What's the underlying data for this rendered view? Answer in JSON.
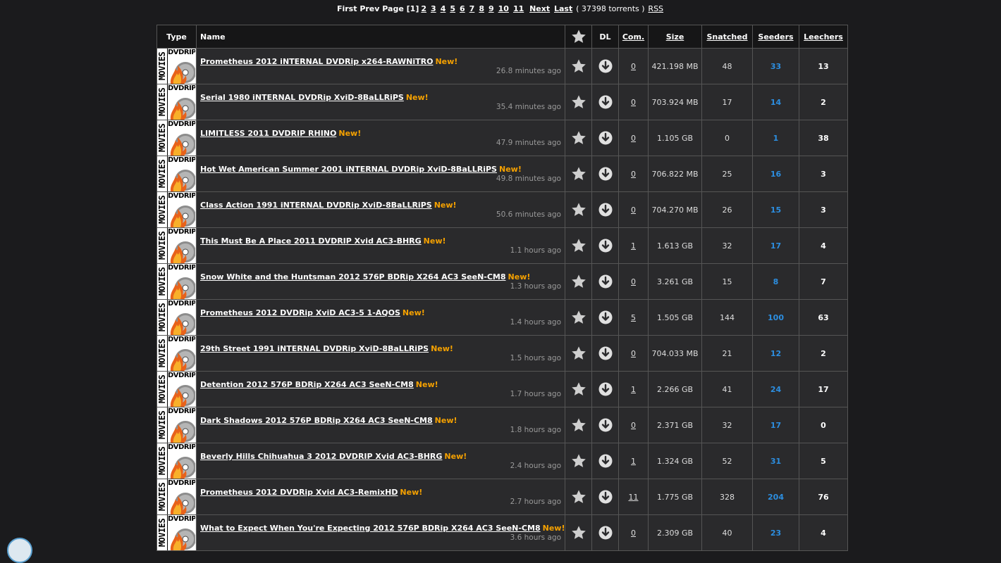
{
  "pager": {
    "first": "First",
    "prev": "Prev",
    "page_label": "Page",
    "current": "[1]",
    "pages": [
      "2",
      "3",
      "4",
      "5",
      "6",
      "7",
      "8",
      "9",
      "10",
      "11"
    ],
    "next": "Next",
    "last": "Last",
    "count_text": "( 37398 torrents )",
    "rss": "RSS"
  },
  "headers": {
    "type": "Type",
    "name": "Name",
    "dl": "DL",
    "com": "Com.",
    "size": "Size",
    "snatched": "Snatched",
    "seeders": "Seeders",
    "leechers": "Leechers"
  },
  "type_icon": {
    "vertical": "MOVIES",
    "top": "DVDRIP"
  },
  "new_label": "New!",
  "colors": {
    "new": "#f5a100",
    "seeders": "#2c8ee0",
    "background": "#1b1b1d"
  },
  "rows": [
    {
      "name": "Prometheus 2012 iNTERNAL DVDRip x264-RAWNiTRO",
      "added": "26.8 minutes ago",
      "com": "0",
      "size": "421.198 MB",
      "snatched": "48",
      "seeders": "33",
      "leechers": "13"
    },
    {
      "name": "Serial 1980 iNTERNAL DVDRip XviD-8BaLLRiPS",
      "added": "35.4 minutes ago",
      "com": "0",
      "size": "703.924 MB",
      "snatched": "17",
      "seeders": "14",
      "leechers": "2"
    },
    {
      "name": "LIMITLESS 2011 DVDRIP RHINO",
      "added": "47.9 minutes ago",
      "com": "0",
      "size": "1.105 GB",
      "snatched": "0",
      "seeders": "1",
      "leechers": "38"
    },
    {
      "name": "Hot Wet American Summer 2001 iNTERNAL DVDRip XviD-8BaLLRiPS",
      "added": "49.8 minutes ago",
      "com": "0",
      "size": "706.822 MB",
      "snatched": "25",
      "seeders": "16",
      "leechers": "3"
    },
    {
      "name": "Class Action 1991 iNTERNAL DVDRip XviD-8BaLLRiPS",
      "added": "50.6 minutes ago",
      "com": "0",
      "size": "704.270 MB",
      "snatched": "26",
      "seeders": "15",
      "leechers": "3"
    },
    {
      "name": "This Must Be A Place 2011 DVDRIP Xvid AC3-BHRG",
      "added": "1.1 hours ago",
      "com": "1",
      "size": "1.613 GB",
      "snatched": "32",
      "seeders": "17",
      "leechers": "4"
    },
    {
      "name": "Snow White and the Huntsman 2012 576P BDRip X264 AC3 SeeN-CM8",
      "added": "1.3 hours ago",
      "com": "0",
      "size": "3.261 GB",
      "snatched": "15",
      "seeders": "8",
      "leechers": "7"
    },
    {
      "name": "Prometheus 2012 DVDRip XviD AC3-5 1-AQOS",
      "added": "1.4 hours ago",
      "com": "5",
      "size": "1.505 GB",
      "snatched": "144",
      "seeders": "100",
      "leechers": "63"
    },
    {
      "name": "29th Street 1991 iNTERNAL DVDRip XviD-8BaLLRiPS",
      "added": "1.5 hours ago",
      "com": "0",
      "size": "704.033 MB",
      "snatched": "21",
      "seeders": "12",
      "leechers": "2"
    },
    {
      "name": "Detention 2012 576P BDRip X264 AC3 SeeN-CM8",
      "added": "1.7 hours ago",
      "com": "1",
      "size": "2.266 GB",
      "snatched": "41",
      "seeders": "24",
      "leechers": "17"
    },
    {
      "name": "Dark Shadows 2012 576P BDRip X264 AC3 SeeN-CM8",
      "added": "1.8 hours ago",
      "com": "0",
      "size": "2.371 GB",
      "snatched": "32",
      "seeders": "17",
      "leechers": "0"
    },
    {
      "name": "Beverly Hills Chihuahua 3 2012 DVDRIP Xvid AC3-BHRG",
      "added": "2.4 hours ago",
      "com": "1",
      "size": "1.324 GB",
      "snatched": "52",
      "seeders": "31",
      "leechers": "5"
    },
    {
      "name": "Prometheus 2012 DVDRip Xvid AC3-RemixHD",
      "added": "2.7 hours ago",
      "com": "11",
      "size": "1.775 GB",
      "snatched": "328",
      "seeders": "204",
      "leechers": "76"
    },
    {
      "name": "What to Expect When You're Expecting 2012 576P BDRip X264 AC3 SeeN-CM8",
      "added": "3.6 hours ago",
      "com": "0",
      "size": "2.309 GB",
      "snatched": "40",
      "seeders": "23",
      "leechers": "4"
    }
  ]
}
